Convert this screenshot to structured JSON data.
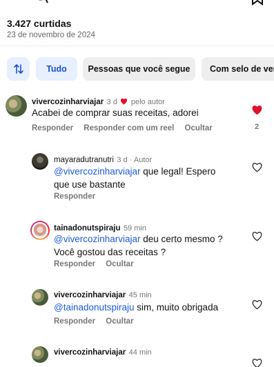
{
  "post": {
    "likes": "3.427 curtidas",
    "date": "23 de novembro de 2024"
  },
  "filters": {
    "all": "Tudo",
    "following": "Pessoas que você segue",
    "badge": "Com selo de verifi"
  },
  "comments": [
    {
      "username": "vivercozinharviajar",
      "time": "3 d",
      "liked_by_author": "pelo autor",
      "text": "Acabei de comprar suas receitas, adorei",
      "actions": [
        "Responder",
        "Responder com um reel",
        "Ocultar"
      ],
      "like_count": "2"
    },
    {
      "username": "mayaradutranutri",
      "time": "3 d",
      "author_label": "Autor",
      "mention": "@vivercozinharviajar",
      "text_line1": " que legal! Espero",
      "text_line2": "que use bastante",
      "actions": [
        "Responder"
      ]
    },
    {
      "username": "tainadonutspiraju",
      "time": "59 min",
      "mention": "@vivercozinharviajar",
      "text_line1": " deu certo mesmo ?",
      "text_line2": "Você gostou das receitas ?",
      "actions": [
        "Responder",
        "Ocultar"
      ]
    },
    {
      "username": "vivercozinharviajar",
      "time": "45 min",
      "mention": "@tainadonutspiraju",
      "text_line1": " sim, muito obrigada",
      "actions": [
        "Responder",
        "Ocultar"
      ]
    },
    {
      "username": "vivercozinharviajar",
      "time": "44 min"
    }
  ],
  "colors": {
    "accent_blue": "#1e5bd6",
    "like_red": "#e0102f",
    "chip_bg": "#eeeeef",
    "chip_active_bg": "#e8effe"
  }
}
